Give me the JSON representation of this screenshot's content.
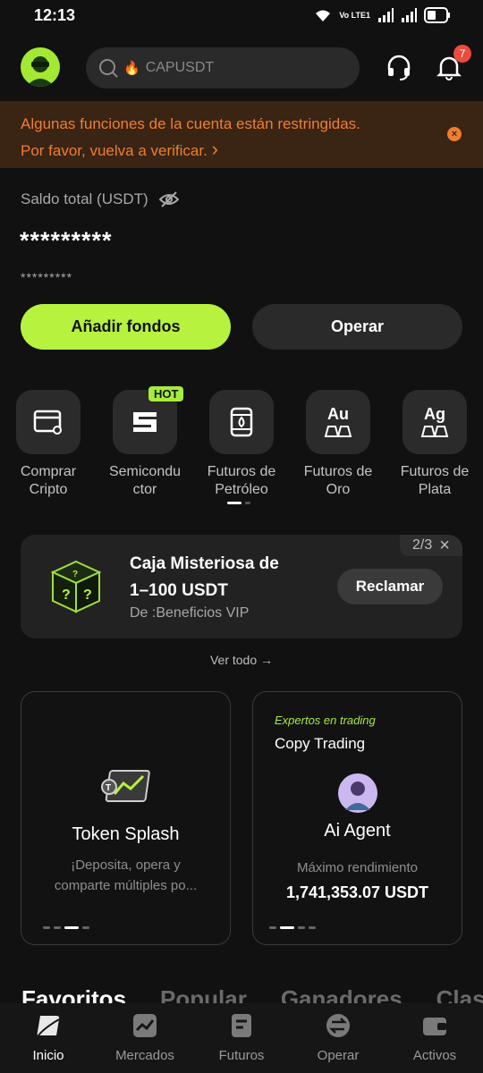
{
  "status_bar": {
    "time": "12:13",
    "network": "Vo LTE1",
    "battery_icon": "battery-icon"
  },
  "header": {
    "search_placeholder": "CAPUSDT",
    "notification_count": "7",
    "icons": [
      "avatar",
      "search-icon",
      "fire-icon",
      "headset-icon",
      "bell-icon"
    ]
  },
  "alert": {
    "line1": "Algunas funciones de la cuenta están restringidas.",
    "line2": "Por favor, vuelva a verificar.",
    "chevron": "›",
    "close": "×",
    "color": "#f07d32"
  },
  "balance": {
    "label": "Saldo total (USDT)",
    "amount": "*********",
    "sub_amount": "*********"
  },
  "actions": {
    "primary": "Añadir fondos",
    "secondary": "Operar",
    "accent": "#b7f23e"
  },
  "quick_links": [
    {
      "label1": "Comprar",
      "label2": "Cripto",
      "icon": "card-icon"
    },
    {
      "label1": "Semicondu",
      "label2": "ctor",
      "icon": "semiconductor-icon",
      "badge": "HOT"
    },
    {
      "label1": "Futuros de",
      "label2": "Petróleo",
      "icon": "oil-barrel-icon"
    },
    {
      "label1": "Futuros de",
      "label2": "Oro",
      "icon": "gold-bars-icon",
      "symbol": "Au"
    },
    {
      "label1": "Futuros de",
      "label2": "Plata",
      "icon": "silver-bars-icon",
      "symbol": "Ag"
    }
  ],
  "promo": {
    "pager": "2/3",
    "close": "×",
    "title_line1": "Caja Misteriosa de",
    "title_line2": "1–100 USDT",
    "subtitle": "De :Beneficios VIP",
    "button": "Reclamar"
  },
  "view_all": "Ver todo →",
  "cards": {
    "token_splash": {
      "title": "Token Splash",
      "desc_line1": "¡Deposita, opera y",
      "desc_line2": "comparte múltiples po..."
    },
    "copy_trading": {
      "tag": "Expertos en trading",
      "title": "Copy Trading",
      "agent": "Ai Agent",
      "metric_label": "Máximo rendimiento",
      "metric_value": "1,741,353.07 USDT"
    }
  },
  "favorites_tabs": [
    "Favoritos",
    "Popular",
    "Ganadores",
    "Clas"
  ],
  "bottom_nav": [
    {
      "label": "Inicio",
      "icon": "home-icon",
      "active": true
    },
    {
      "label": "Mercados",
      "icon": "chart-icon",
      "active": false
    },
    {
      "label": "Futuros",
      "icon": "futures-icon",
      "active": false
    },
    {
      "label": "Operar",
      "icon": "trade-icon",
      "active": false
    },
    {
      "label": "Activos",
      "icon": "wallet-icon",
      "active": false
    }
  ]
}
